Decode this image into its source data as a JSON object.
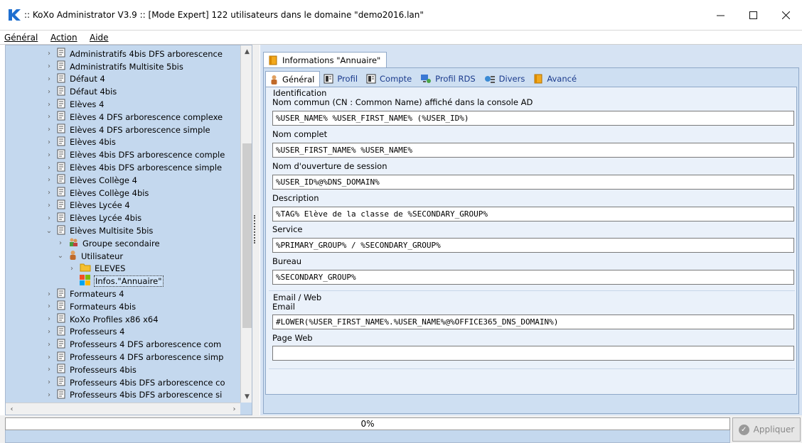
{
  "window": {
    "title": ":: KoXo Administrator V3.9 :: [Mode Expert] 122 utilisateurs dans le domaine \"demo2016.lan\"",
    "minimize_glyph": "—",
    "maximize_glyph": "☐",
    "close_glyph": "✕"
  },
  "menu": [
    "Général",
    "Action",
    "Aide"
  ],
  "tree": {
    "items": [
      {
        "label": "Administratifs 4bis DFS arborescence",
        "level": 0,
        "chev": "›",
        "icon": "doc"
      },
      {
        "label": "Administratifs Multisite 5bis",
        "level": 0,
        "chev": "›",
        "icon": "doc"
      },
      {
        "label": "Défaut 4",
        "level": 0,
        "chev": "›",
        "icon": "doc"
      },
      {
        "label": "Défaut 4bis",
        "level": 0,
        "chev": "›",
        "icon": "doc"
      },
      {
        "label": "Elèves 4",
        "level": 0,
        "chev": "›",
        "icon": "doc"
      },
      {
        "label": "Elèves 4 DFS arborescence complexe",
        "level": 0,
        "chev": "›",
        "icon": "doc"
      },
      {
        "label": "Elèves 4 DFS arborescence simple",
        "level": 0,
        "chev": "›",
        "icon": "doc"
      },
      {
        "label": "Elèves 4bis",
        "level": 0,
        "chev": "›",
        "icon": "doc"
      },
      {
        "label": "Elèves 4bis DFS arborescence comple",
        "level": 0,
        "chev": "›",
        "icon": "doc"
      },
      {
        "label": "Elèves 4bis DFS arborescence simple",
        "level": 0,
        "chev": "›",
        "icon": "doc"
      },
      {
        "label": "Elèves Collège 4",
        "level": 0,
        "chev": "›",
        "icon": "doc"
      },
      {
        "label": "Elèves Collège 4bis",
        "level": 0,
        "chev": "›",
        "icon": "doc"
      },
      {
        "label": "Elèves Lycée 4",
        "level": 0,
        "chev": "›",
        "icon": "doc"
      },
      {
        "label": "Elèves Lycée 4bis",
        "level": 0,
        "chev": "›",
        "icon": "doc"
      },
      {
        "label": "Elèves Multisite 5bis",
        "level": 0,
        "chev": "⌄",
        "icon": "doc"
      },
      {
        "label": "Groupe secondaire",
        "level": 1,
        "chev": "›",
        "icon": "group"
      },
      {
        "label": "Utilisateur",
        "level": 1,
        "chev": "⌄",
        "icon": "user"
      },
      {
        "label": "ELEVES",
        "level": 2,
        "chev": "›",
        "icon": "folder"
      },
      {
        "label": "Infos.\"Annuaire\"",
        "level": 2,
        "chev": "",
        "icon": "windows",
        "selected": true
      },
      {
        "label": "Formateurs 4",
        "level": 0,
        "chev": "›",
        "icon": "doc"
      },
      {
        "label": "Formateurs 4bis",
        "level": 0,
        "chev": "›",
        "icon": "doc"
      },
      {
        "label": "KoXo Profiles x86 x64",
        "level": 0,
        "chev": "›",
        "icon": "doc"
      },
      {
        "label": "Professeurs 4",
        "level": 0,
        "chev": "›",
        "icon": "doc"
      },
      {
        "label": "Professeurs 4 DFS arborescence com",
        "level": 0,
        "chev": "›",
        "icon": "doc"
      },
      {
        "label": "Professeurs 4 DFS arborescence simp",
        "level": 0,
        "chev": "›",
        "icon": "doc"
      },
      {
        "label": "Professeurs 4bis",
        "level": 0,
        "chev": "›",
        "icon": "doc"
      },
      {
        "label": "Professeurs 4bis DFS arborescence co",
        "level": 0,
        "chev": "›",
        "icon": "doc"
      },
      {
        "label": "Professeurs 4bis DFS arborescence si",
        "level": 0,
        "chev": "›",
        "icon": "doc"
      }
    ]
  },
  "main_tab": {
    "label": "Informations \"Annuaire\""
  },
  "subtabs": [
    {
      "label": "Général",
      "icon": "user",
      "active": true
    },
    {
      "label": "Profil",
      "icon": "profile"
    },
    {
      "label": "Compte",
      "icon": "profile"
    },
    {
      "label": "Profil RDS",
      "icon": "rds"
    },
    {
      "label": "Divers",
      "icon": "misc"
    },
    {
      "label": "Avancé",
      "icon": "book"
    }
  ],
  "form": {
    "identification_title": "Identification",
    "cn_label": "Nom commun (CN : Common Name) affiché dans la console AD",
    "cn_value": "%USER_NAME% %USER_FIRST_NAME% (%USER_ID%)",
    "fullname_label": "Nom complet",
    "fullname_value": "%USER_FIRST_NAME% %USER_NAME%",
    "logon_label": "Nom d'ouverture de session",
    "logon_value": "%USER_ID%@%DNS_DOMAIN%",
    "description_label": "Description",
    "description_value": "%TAG% Elève de la classe de %SECONDARY_GROUP%",
    "service_label": "Service",
    "service_value": "%PRIMARY_GROUP% / %SECONDARY_GROUP%",
    "bureau_label": "Bureau",
    "bureau_value": "%SECONDARY_GROUP%",
    "emailweb_title": "Email / Web",
    "email_label": "Email",
    "email_value": "#LOWER(%USER_FIRST_NAME%.%USER_NAME%@%OFFICE365_DNS_DOMAIN%)",
    "web_label": "Page Web",
    "web_value": ""
  },
  "status": {
    "progress_text": "0%",
    "progress": 0,
    "apply_label": "Appliquer"
  },
  "colors": {
    "tree_bg": "#c4d8ee",
    "panel_bg": "#d6e3f3",
    "logo_blue": "#1f6fd0"
  }
}
